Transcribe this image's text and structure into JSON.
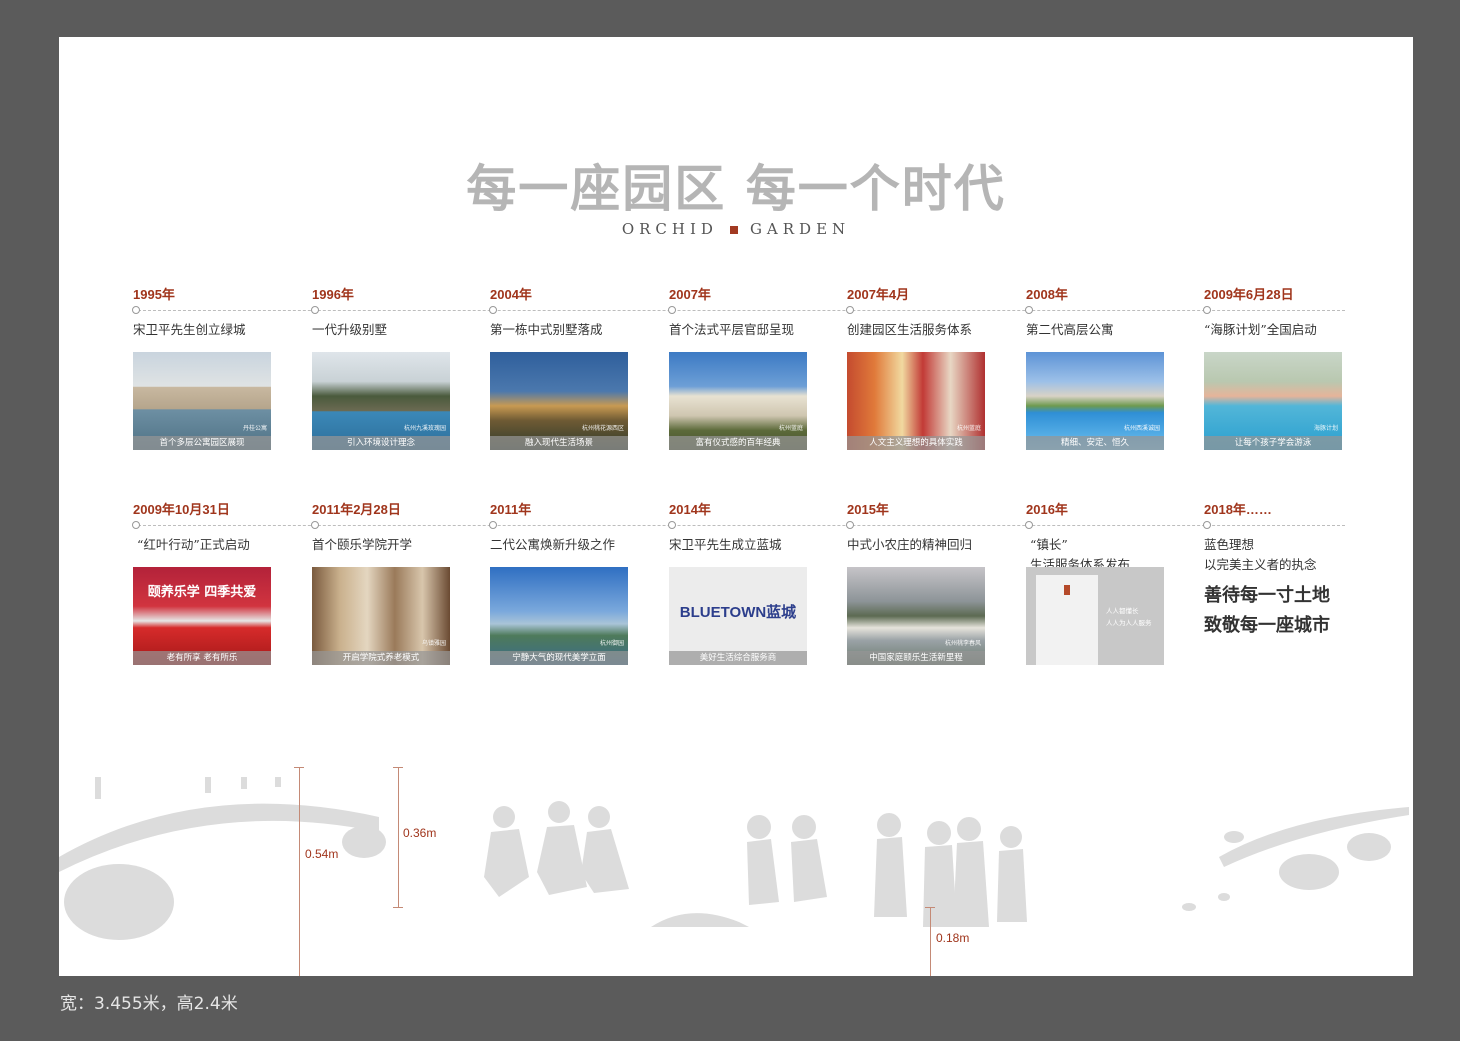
{
  "header": {
    "title": "每一座园区  每一个时代",
    "subtitle_left": "ORCHID",
    "subtitle_right": "GARDEN"
  },
  "timeline": {
    "row1": [
      {
        "date": "1995年",
        "text": "宋卫平先生创立绿城",
        "caption": "首个多层公寓园区展现",
        "tag": "丹桂公寓"
      },
      {
        "date": "1996年",
        "text": "一代升级别墅",
        "caption": "引入环境设计理念",
        "tag": "杭州九溪玫瑰园"
      },
      {
        "date": "2004年",
        "text": "第一栋中式别墅落成",
        "caption": "融入现代生活场景",
        "tag": "杭州桃花源西区"
      },
      {
        "date": "2007年",
        "text": "首个法式平层官邸呈现",
        "caption": "富有仪式感的百年经典",
        "tag": "杭州蓝庭"
      },
      {
        "date": "2007年4月",
        "text": "创建园区生活服务体系",
        "caption": "人文主义理想的具体实践",
        "tag": "杭州蓝庭"
      },
      {
        "date": "2008年",
        "text": "第二代高层公寓",
        "caption": "精细、安定、恒久",
        "tag": "杭州西溪诚园"
      },
      {
        "date": "2009年6月28日",
        "text": "“海豚计划”全国启动",
        "caption": "让每个孩子学会游泳",
        "tag": "海豚计划"
      }
    ],
    "row2": [
      {
        "date": "2009年10月31日",
        "text": "“红叶行动”正式启动",
        "caption": "老有所享 老有所乐",
        "tag": "",
        "banner": "颐养乐学  四季共爱"
      },
      {
        "date": "2011年2月28日",
        "text": "首个颐乐学院开学",
        "caption": "开启学院式养老模式",
        "tag": "乌镇雅园"
      },
      {
        "date": "2011年",
        "text": "二代公寓焕新升级之作",
        "caption": "宁静大气的现代美学立面",
        "tag": "杭州御园"
      },
      {
        "date": "2014年",
        "text": "宋卫平先生成立蓝城",
        "caption": "美好生活综合服务商",
        "tag": "",
        "logo": "BLUETOWN蓝城"
      },
      {
        "date": "2015年",
        "text": "中式小农庄的精神回归",
        "caption": "中国家庭颐乐生活新里程",
        "tag": "杭州桃李春风"
      },
      {
        "date": "2016年",
        "text": "“镇长”\n生活服务体系发布",
        "caption": "",
        "tag": "",
        "book_text": "人人都懂长\n人人为人人服务"
      },
      {
        "date": "2018年……",
        "text": "蓝色理想\n以完美主义者的执念",
        "caption": "",
        "tag": "",
        "slogan": "善待每一寸土地\n致敬每一座城市"
      }
    ]
  },
  "dimensions": {
    "a": "0.54m",
    "b": "0.36m",
    "c": "0.18m"
  },
  "footer": {
    "text": "宽：3.455米，高2.4米"
  },
  "colors": {
    "accent": "#a0351c",
    "title_gray": "#b5b5b5",
    "silhouette": "#d9d9d9",
    "frame": "#5b5b5b"
  }
}
